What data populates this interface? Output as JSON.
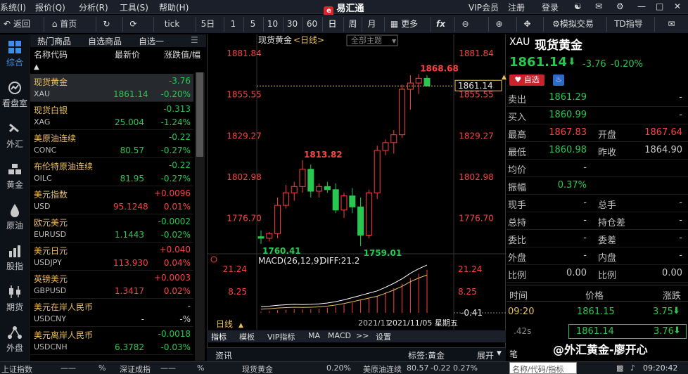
{
  "menubar": {
    "menus": [
      "系统(I)",
      "报价(Q)",
      "分析(R)",
      "工具(S)",
      "帮助(H)"
    ],
    "app_title": "易汇通",
    "right_items": [
      "VIP会员",
      "注册",
      "登录"
    ]
  },
  "toolbar": {
    "back": "返回",
    "home": "首页",
    "tick": "tick",
    "periods": [
      "5日",
      "1",
      "5",
      "10",
      "30",
      "60",
      "日",
      "周",
      "月"
    ],
    "more": "更多",
    "sim_trade": "模拟交易",
    "td_guide": "TD指导"
  },
  "leftnav": [
    "综合",
    "看盘室",
    "外汇",
    "黄金",
    "原油",
    "股指",
    "期货",
    "外盘"
  ],
  "quote_tabs": [
    "热门商品",
    "自选商品",
    "自选一"
  ],
  "quote_header": {
    "name": "名称代码",
    "price": "最新价",
    "change": "涨跌值/幅"
  },
  "quotes": [
    {
      "name": "现货黄金",
      "code": "XAU",
      "change": "-3.76",
      "price": "1861.14",
      "pct": "-0.20%",
      "dir": "dn",
      "sel": true
    },
    {
      "name": "现货白银",
      "code": "XAG",
      "change": "-0.313",
      "price": "25.004",
      "pct": "-1.24%",
      "dir": "dn"
    },
    {
      "name": "美原油连续",
      "code": "CONC",
      "change": "-0.22",
      "price": "80.57",
      "pct": "-0.27%",
      "dir": "dn"
    },
    {
      "name": "布伦特原油连续",
      "code": "OILC",
      "change": "-0.22",
      "price": "81.95",
      "pct": "-0.27%",
      "dir": "dn"
    },
    {
      "name": "美元指数",
      "code": "USD",
      "change": "+0.0096",
      "price": "95.1248",
      "pct": "0.01%",
      "dir": "up"
    },
    {
      "name": "欧元美元",
      "code": "EURUSD",
      "change": "-0.0002",
      "price": "1.1443",
      "pct": "-0.02%",
      "dir": "dn"
    },
    {
      "name": "美元日元",
      "code": "USDJPY",
      "change": "+0.040",
      "price": "113.930",
      "pct": "0.04%",
      "dir": "up"
    },
    {
      "name": "英镑美元",
      "code": "GBPUSD",
      "change": "+0.0003",
      "price": "1.3417",
      "pct": "0.02%",
      "dir": "up"
    },
    {
      "name": "美元在岸人民币",
      "code": "USDCNY",
      "change": "-",
      "price": "-",
      "pct": "-%",
      "dir": "ne"
    },
    {
      "name": "美元离岸人民币",
      "code": "USDCNH",
      "change": "-0.0018",
      "price": "6.3782",
      "pct": "-0.03%",
      "dir": "dn"
    }
  ],
  "chart_header": {
    "title": "现货黄金",
    "period": "<日线>",
    "theme": "全部主题"
  },
  "chart_labels": {
    "high": "1868.68",
    "peak2": "1813.82",
    "low1": "1760.41",
    "low2": "1759.01",
    "current": "1861.14"
  },
  "yticks": [
    "1881.84",
    "1855.55",
    "1829.27",
    "1802.98",
    "1776.70"
  ],
  "macd": {
    "label": "MACD(26,12,9)",
    "diff": "DIFF:21.2",
    "ticks": [
      "21.24",
      "8.25",
      "-0.41"
    ]
  },
  "date_bar": {
    "period": "日线",
    "date1": "2021/11",
    "date2": "2021/11/05 星期五"
  },
  "chart_tabs": [
    "指标",
    "模板",
    "VIP指标",
    "MA",
    "MACD",
    ">>",
    "设置"
  ],
  "chart_data": {
    "type": "candlestick",
    "ylim": [
      1755.0,
      1885.0
    ],
    "candles": [
      {
        "o": 1765,
        "h": 1769,
        "l": 1760.41,
        "c": 1764
      },
      {
        "o": 1764,
        "h": 1768,
        "l": 1762,
        "c": 1767
      },
      {
        "o": 1767,
        "h": 1790,
        "l": 1764,
        "c": 1785
      },
      {
        "o": 1785,
        "h": 1798,
        "l": 1783,
        "c": 1793
      },
      {
        "o": 1793,
        "h": 1800,
        "l": 1788,
        "c": 1797
      },
      {
        "o": 1797,
        "h": 1813.82,
        "l": 1793,
        "c": 1808
      },
      {
        "o": 1808,
        "h": 1811,
        "l": 1790,
        "c": 1794
      },
      {
        "o": 1794,
        "h": 1799,
        "l": 1790,
        "c": 1797
      },
      {
        "o": 1797,
        "h": 1800,
        "l": 1793,
        "c": 1795
      },
      {
        "o": 1795,
        "h": 1799,
        "l": 1780,
        "c": 1782
      },
      {
        "o": 1782,
        "h": 1793,
        "l": 1777,
        "c": 1791
      },
      {
        "o": 1791,
        "h": 1796,
        "l": 1780,
        "c": 1784
      },
      {
        "o": 1784,
        "h": 1790,
        "l": 1759.01,
        "c": 1766
      },
      {
        "o": 1766,
        "h": 1795,
        "l": 1764,
        "c": 1793
      },
      {
        "o": 1793,
        "h": 1823,
        "l": 1789,
        "c": 1820
      },
      {
        "o": 1820,
        "h": 1827,
        "l": 1817,
        "c": 1825
      },
      {
        "o": 1825,
        "h": 1833,
        "l": 1818,
        "c": 1830
      },
      {
        "o": 1830,
        "h": 1862,
        "l": 1828,
        "c": 1859
      },
      {
        "o": 1859,
        "h": 1868,
        "l": 1846,
        "c": 1863
      },
      {
        "o": 1863,
        "h": 1868.68,
        "l": 1856,
        "c": 1866
      },
      {
        "o": 1866,
        "h": 1867.83,
        "l": 1860.98,
        "c": 1861.14
      }
    ],
    "macd_hist": [
      0.5,
      0.8,
      1.2,
      1.4,
      1.6,
      1.5,
      1.6,
      1.8,
      2.2,
      2.8,
      3.6,
      4.6,
      5.6,
      6.6,
      7.6,
      9.2,
      11,
      13,
      15.5,
      17.5,
      19.2
    ]
  },
  "info": {
    "symbol": "XAU",
    "name": "现货黄金",
    "price": "1861.14",
    "change": "-3.76",
    "pct": "-0.20%",
    "watch": "自选",
    "rows": [
      {
        "l1": "卖出",
        "v1": "1861.29",
        "l2": "",
        "v2": "-",
        "c1": "dn",
        "c2": "ne"
      },
      {
        "l1": "买入",
        "v1": "1860.99",
        "l2": "",
        "v2": "-",
        "c1": "dn",
        "c2": "ne"
      },
      {
        "l1": "最高",
        "v1": "1867.83",
        "l2": "开盘",
        "v2": "1867.64",
        "c1": "up",
        "c2": "up"
      },
      {
        "l1": "最低",
        "v1": "1860.98",
        "l2": "昨收",
        "v2": "1864.90",
        "c1": "dn",
        "c2": "ne"
      },
      {
        "l1": "均价",
        "v1": "-",
        "l2": "",
        "v2": "",
        "c1": "ne",
        "c2": "ne"
      },
      {
        "l1": "振幅",
        "v1": "0.37%",
        "l2": "",
        "v2": "",
        "c1": "dn",
        "c2": "ne"
      },
      {
        "l1": "现手",
        "v1": "-",
        "l2": "总手",
        "v2": "-",
        "c1": "ne",
        "c2": "ne"
      },
      {
        "l1": "总持",
        "v1": "-",
        "l2": "持仓差",
        "v2": "-",
        "c1": "ne",
        "c2": "ne"
      },
      {
        "l1": "委比",
        "v1": "-",
        "l2": "委差",
        "v2": "-",
        "c1": "ne",
        "c2": "ne"
      },
      {
        "l1": "外盘",
        "v1": "-",
        "l2": "内盘",
        "v2": "-",
        "c1": "ne",
        "c2": "ne"
      },
      {
        "l1": "比例",
        "v1": "0.00",
        "l2": "比例",
        "v2": "0.00",
        "c1": "ne",
        "c2": "ne"
      }
    ],
    "trade_head": [
      "时间",
      "价格",
      "涨跌"
    ],
    "trades": [
      {
        "t": "09:20",
        "p": "1861.15",
        "d": "3.75"
      },
      {
        "t": ".42s",
        "p": "1861.14",
        "d": "3.76"
      }
    ],
    "search_placeholder": "名称/代码/指标",
    "pen": "笔"
  },
  "bottom": {
    "left": "上证指数",
    "pct1": "%",
    "sz": "深证成指",
    "pct2": "%",
    "g_name": "现货黄金",
    "g_pct": "0.20%",
    "o_name": "美原油连续",
    "o_val": "80.57",
    "o_chg": "-0.22",
    "o_pct": "0.27%",
    "news": "资讯",
    "tag": "标签:黄金",
    "expand": "展开",
    "watermark": "@外汇黄金-廖开心",
    "time": "09:20:42"
  }
}
